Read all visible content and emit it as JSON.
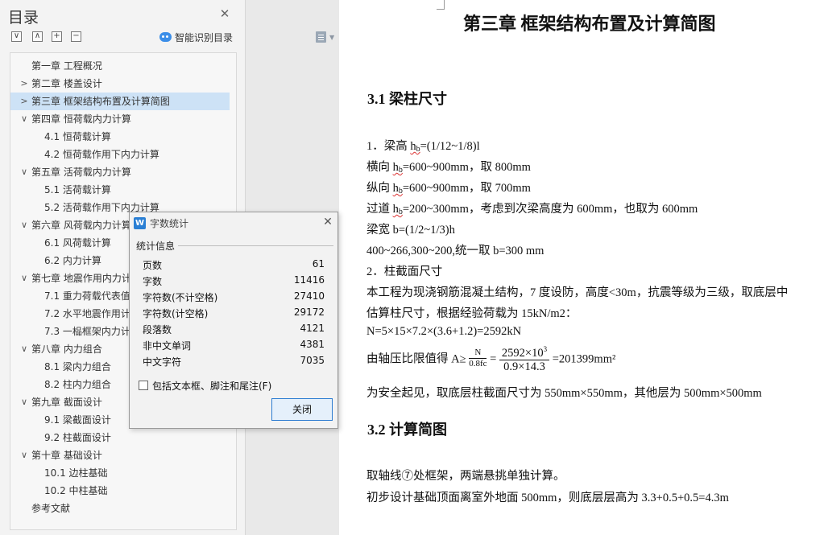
{
  "nav": {
    "title": "目录",
    "smart_toc_label": "智能识别目录",
    "tool_buttons": [
      "∨",
      "∧",
      "+",
      "−"
    ],
    "icons": {
      "close": "close-icon",
      "smart": "smart-toc-icon"
    },
    "items": [
      {
        "text": "第一章  工程概况",
        "level": 0,
        "arrow": ""
      },
      {
        "text": "第二章  楼盖设计",
        "level": 0,
        "arrow": ">"
      },
      {
        "text": "第三章  框架结构布置及计算简图",
        "level": 0,
        "arrow": ">",
        "selected": true
      },
      {
        "text": "第四章  恒荷载内力计算",
        "level": 0,
        "arrow": "∨"
      },
      {
        "text": "4.1  恒荷载计算",
        "level": 1,
        "arrow": ""
      },
      {
        "text": "4.2  恒荷载作用下内力计算",
        "level": 1,
        "arrow": ""
      },
      {
        "text": "第五章  活荷载内力计算",
        "level": 0,
        "arrow": "∨"
      },
      {
        "text": "5.1  活荷载计算",
        "level": 1,
        "arrow": ""
      },
      {
        "text": "5.2  活荷载作用下内力计算",
        "level": 1,
        "arrow": ""
      },
      {
        "text": "第六章  风荷载内力计算",
        "level": 0,
        "arrow": "∨"
      },
      {
        "text": "6.1  风荷载计算",
        "level": 1,
        "arrow": ""
      },
      {
        "text": "6.2  内力计算",
        "level": 1,
        "arrow": ""
      },
      {
        "text": "第七章  地震作用内力计",
        "level": 0,
        "arrow": "∨"
      },
      {
        "text": "7.1  重力荷载代表值",
        "level": 1,
        "arrow": ""
      },
      {
        "text": "7.2  水平地震作用计",
        "level": 1,
        "arrow": ""
      },
      {
        "text": "7.3  一榀框架内力计",
        "level": 1,
        "arrow": ""
      },
      {
        "text": "第八章  内力组合",
        "level": 0,
        "arrow": "∨"
      },
      {
        "text": "8.1  梁内力组合",
        "level": 1,
        "arrow": ""
      },
      {
        "text": "8.2  柱内力组合",
        "level": 1,
        "arrow": ""
      },
      {
        "text": "第九章  截面设计",
        "level": 0,
        "arrow": "∨"
      },
      {
        "text": "9.1  梁截面设计",
        "level": 1,
        "arrow": ""
      },
      {
        "text": "9.2  柱截面设计",
        "level": 1,
        "arrow": ""
      },
      {
        "text": "第十章  基础设计",
        "level": 0,
        "arrow": "∨"
      },
      {
        "text": "10.1  边柱基础",
        "level": 1,
        "arrow": ""
      },
      {
        "text": "10.2  中柱基础",
        "level": 1,
        "arrow": ""
      },
      {
        "text": "参考文献",
        "level": 0,
        "arrow": ""
      }
    ]
  },
  "dialog": {
    "title": "字数统计",
    "icon_letter": "W",
    "group_label": "统计信息",
    "stats": [
      {
        "label": "页数",
        "value": "61"
      },
      {
        "label": "字数",
        "value": "11416"
      },
      {
        "label": "字符数(不计空格)",
        "value": "27410"
      },
      {
        "label": "字符数(计空格)",
        "value": "29172"
      },
      {
        "label": "段落数",
        "value": "4121"
      },
      {
        "label": "非中文单词",
        "value": "4381"
      },
      {
        "label": "中文字符",
        "value": "7035"
      }
    ],
    "checkbox_label": "包括文本框、脚注和尾注(F)",
    "checkbox_checked": false,
    "close_button": "关闭"
  },
  "doc": {
    "chapter_title": "第三章  框架结构布置及计算简图",
    "sec1": "3.1  梁柱尺寸",
    "sec2": "3.2  计算简图",
    "l1_pre": "1．梁高  ",
    "h": "h",
    "b_sub": "b",
    "l1_post": "=(1/12~1/8)l",
    "l2_pre": "横向  ",
    "l2_post": "=600~900mm，取 800mm",
    "l3_pre": "纵向  ",
    "l3_post": "=600~900mm，取 700mm",
    "l4_pre": "过道  ",
    "l4_post": "=200~300mm，考虑到次梁高度为 600mm，也取为 600mm",
    "l5": "梁宽  b=(1/2~1/3)h",
    "l6": "400~266,300~200,统一取 b=300 mm",
    "l7": "2．柱截面尺寸",
    "l8": "本工程为现浇钢筋混凝土结构，7 度设防，高度<30m，抗震等级为三级，取底层中",
    "l9": "估算柱尺寸，根据经验荷载为 15kN/m2：",
    "l10": "N=5×15×7.2×(3.6+1.2)=2592kN",
    "l11_pre": "由轴压比限值得 A≥",
    "f1_num": "N",
    "f1_den": "0.8fc",
    "eq": "=",
    "f2_num": "2592×10",
    "f2_sup": "3",
    "f2_den": "0.9×14.3",
    "l11_post": "=201399mm²",
    "l12": "为安全起见，取底层柱截面尺寸为 550mm×550mm，其他层为 500mm×500mm",
    "l13": "取轴线⑦处框架，两端悬挑单独计算。",
    "l14": "初步设计基础顶面离室外地面 500mm，则底层层高为 3.3+0.5+0.5=4.3m"
  }
}
